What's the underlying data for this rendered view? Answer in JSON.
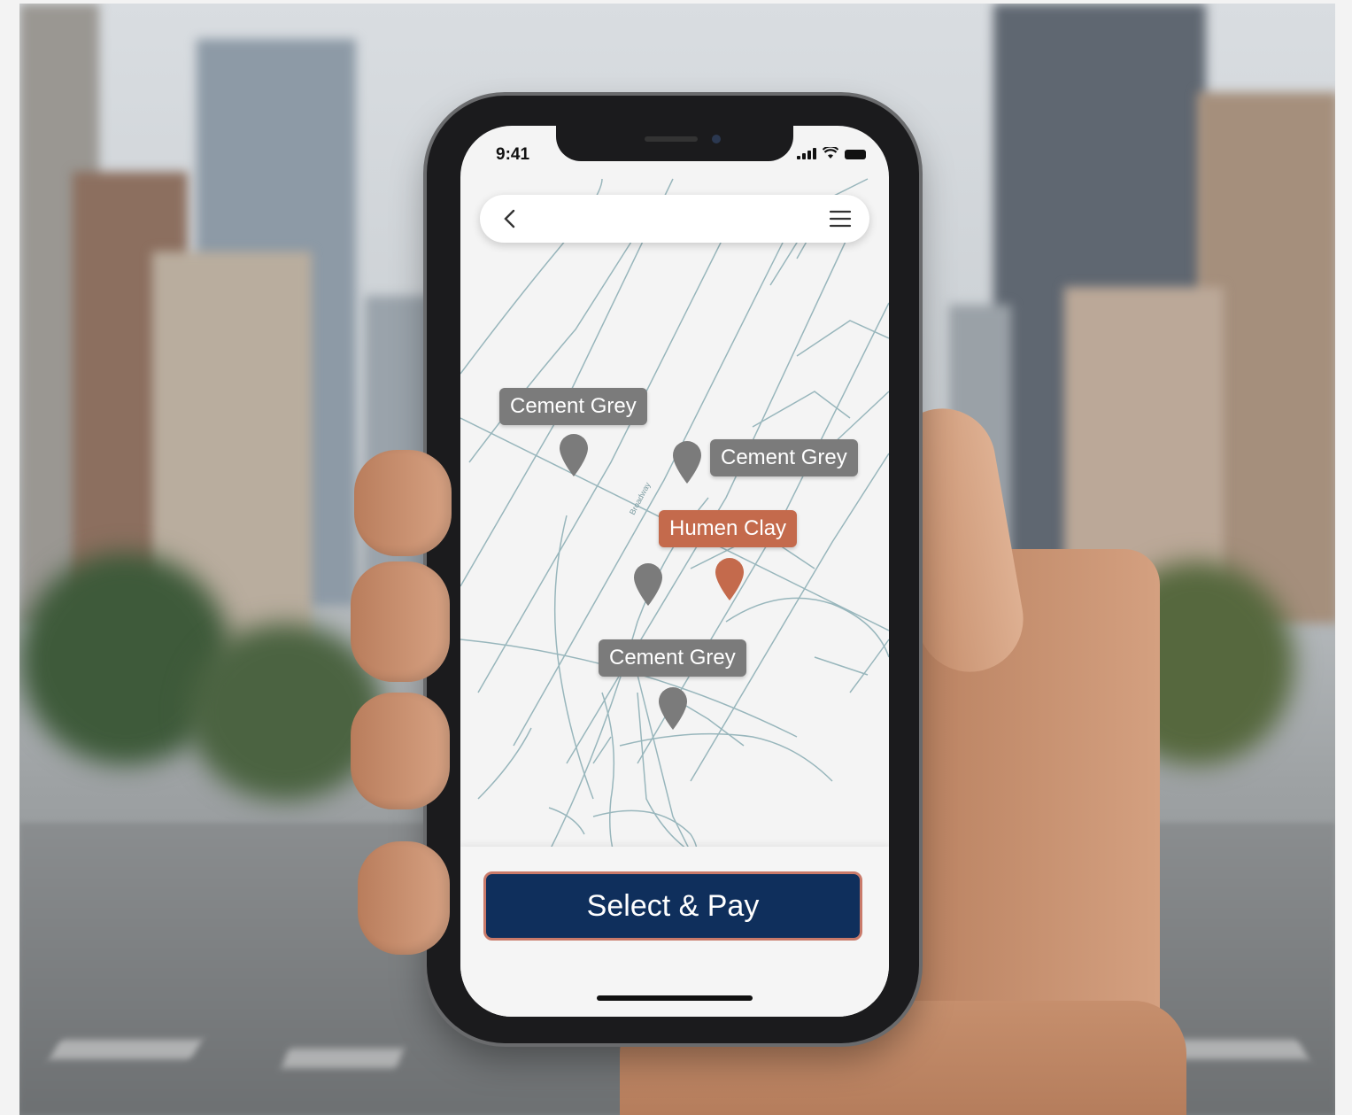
{
  "status_bar": {
    "time": "9:41"
  },
  "header": {
    "back_icon": "chevron-left-icon",
    "menu_icon": "hamburger-menu-icon"
  },
  "map": {
    "markers": [
      {
        "label": "Cement Grey",
        "color": "#7b7b7b",
        "selected": false
      },
      {
        "label": "Cement Grey",
        "color": "#7b7b7b",
        "selected": false
      },
      {
        "label": "Humen Clay",
        "color": "#c46a4c",
        "selected": true
      },
      {
        "label": "Cement Grey",
        "color": "#7b7b7b",
        "selected": false
      }
    ],
    "street_label": "Broadway"
  },
  "action": {
    "button_label": "Select & Pay",
    "button_color": "#0f2f5c",
    "button_border": "#c97a6a"
  }
}
